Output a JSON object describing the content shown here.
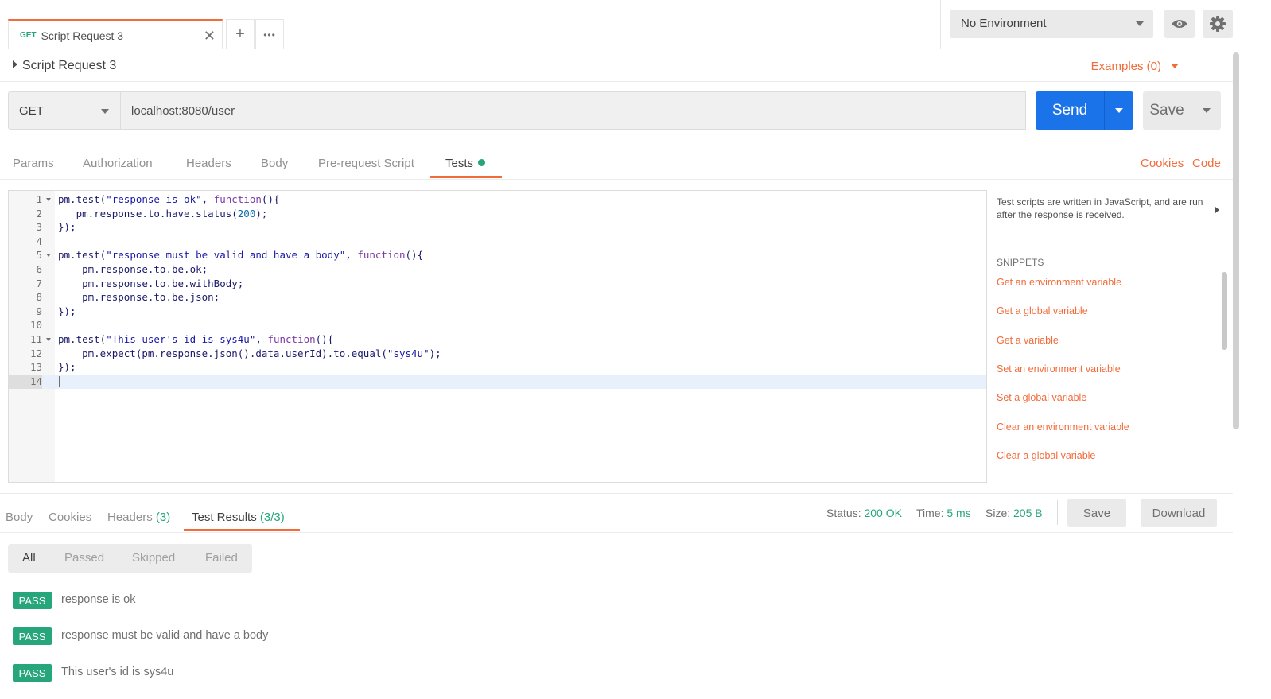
{
  "tab": {
    "method": "GET",
    "title": "Script Request 3",
    "close": "✕",
    "add": "+",
    "more": "•••"
  },
  "environment": {
    "selected": "No Environment"
  },
  "request": {
    "name": "Script Request 3",
    "examples_label": "Examples (0)",
    "method": "GET",
    "url": "localhost:8080/user",
    "send_label": "Send",
    "save_label": "Save"
  },
  "request_tabs": [
    {
      "label": "Params"
    },
    {
      "label": "Authorization"
    },
    {
      "label": "Headers"
    },
    {
      "label": "Body"
    },
    {
      "label": "Pre-request Script"
    },
    {
      "label": "Tests"
    }
  ],
  "request_links": {
    "cookies": "Cookies",
    "code": "Code"
  },
  "editor": {
    "active_line": 14,
    "lines": [
      {
        "n": "1",
        "text": "pm.test(\"response is ok\", function(){"
      },
      {
        "n": "2",
        "text": "   pm.response.to.have.status(200);"
      },
      {
        "n": "3",
        "text": "});"
      },
      {
        "n": "4",
        "text": ""
      },
      {
        "n": "5",
        "text": "pm.test(\"response must be valid and have a body\", function(){"
      },
      {
        "n": "6",
        "text": "    pm.response.to.be.ok;"
      },
      {
        "n": "7",
        "text": "    pm.response.to.be.withBody;"
      },
      {
        "n": "8",
        "text": "    pm.response.to.be.json;"
      },
      {
        "n": "9",
        "text": "});"
      },
      {
        "n": "10",
        "text": ""
      },
      {
        "n": "11",
        "text": "pm.test(\"This user's id is sys4u\", function(){"
      },
      {
        "n": "12",
        "text": "    pm.expect(pm.response.json().data.userId).to.equal(\"sys4u\");"
      },
      {
        "n": "13",
        "text": "});"
      },
      {
        "n": "14",
        "text": ""
      }
    ]
  },
  "snippets": {
    "description": "Test scripts are written in JavaScript, and are run after the response is received.",
    "heading": "SNIPPETS",
    "items": [
      "Get an environment variable",
      "Get a global variable",
      "Get a variable",
      "Set an environment variable",
      "Set a global variable",
      "Clear an environment variable",
      "Clear a global variable"
    ]
  },
  "response": {
    "tabs": {
      "body": "Body",
      "cookies": "Cookies",
      "headers": "Headers",
      "headers_count": "(3)",
      "test_results": "Test Results",
      "test_results_count": "(3/3)"
    },
    "status_label": "Status:",
    "status_value": "200 OK",
    "time_label": "Time:",
    "time_value": "5 ms",
    "size_label": "Size:",
    "size_value": "205 B",
    "save_label": "Save",
    "download_label": "Download"
  },
  "filters": [
    "All",
    "Passed",
    "Skipped",
    "Failed"
  ],
  "results": [
    {
      "status": "PASS",
      "name": "response is ok"
    },
    {
      "status": "PASS",
      "name": "response must be valid and have a body"
    },
    {
      "status": "PASS",
      "name": "This user's id is sys4u"
    }
  ],
  "colors": {
    "accent": "#f26b3a",
    "primary": "#1a73e8",
    "success": "#26a67a"
  },
  "icons": {
    "visibility": "eye-icon",
    "settings": "gear-icon"
  }
}
